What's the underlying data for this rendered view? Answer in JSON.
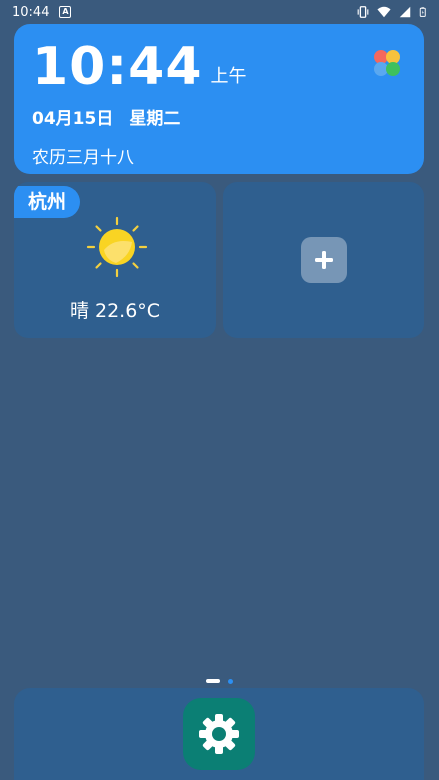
{
  "status_bar": {
    "time": "10:44",
    "icons": [
      "a-notification-icon",
      "vibrate-icon",
      "wifi-icon",
      "signal-icon",
      "battery-icon"
    ]
  },
  "clock_widget": {
    "time": "10:44",
    "ampm": "上午",
    "date": "04月15日",
    "weekday": "星期二",
    "lunar": "农历三月十八",
    "icon": "colorful-petal-icon"
  },
  "weather_widget": {
    "city": "杭州",
    "condition_icon": "sun-icon",
    "summary": "晴 22.6°C"
  },
  "add_widget": {
    "icon": "plus-icon"
  },
  "pager": {
    "pages": 2,
    "current": 1
  },
  "dock": {
    "apps": [
      {
        "icon": "gear-icon",
        "color": "#0b7f74"
      }
    ]
  },
  "colors": {
    "background": "#3a5a7d",
    "card_accent": "#2c8ff2",
    "card_dark": "#2f5f8f"
  }
}
